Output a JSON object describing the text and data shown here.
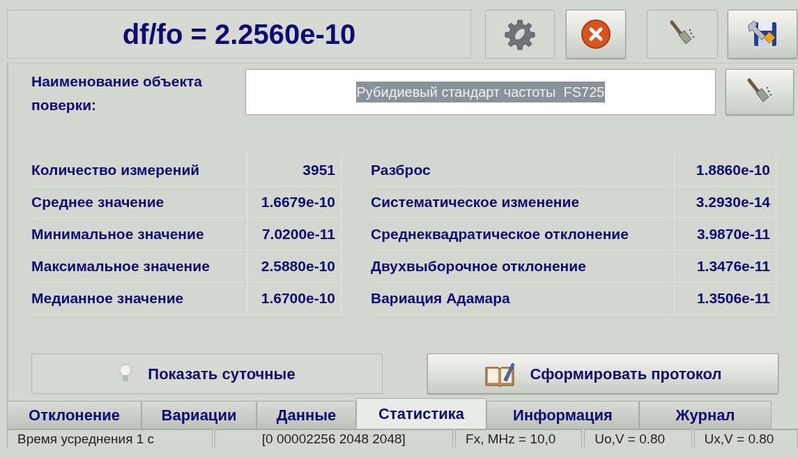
{
  "header": {
    "title": "df/fo = 2.2560e-10"
  },
  "toolbar": [
    {
      "kind": "settings",
      "raised": false
    },
    {
      "kind": "close",
      "raised": true
    },
    {
      "kind": "brush",
      "raised": false
    },
    {
      "kind": "save",
      "raised": true
    }
  ],
  "object_field": {
    "label": "Наименование объекта поверки:",
    "value": "Рубидиевый стандарт частоты  FS725",
    "highlighted": true,
    "clear_button": {
      "kind": "brush",
      "raised": true
    }
  },
  "stats_left": [
    {
      "label": "Количество измерений",
      "value": "3951"
    },
    {
      "label": "Среднее значение",
      "value": "1.6679e-10"
    },
    {
      "label": "Минимальное значение",
      "value": "7.0200e-11"
    },
    {
      "label": "Максимальное значение",
      "value": "2.5880e-10"
    },
    {
      "label": "Медианное значение",
      "value": "1.6700e-10"
    }
  ],
  "stats_right": [
    {
      "label": "Разброс",
      "value": "1.8860e-10"
    },
    {
      "label": "Систематическое изменение",
      "value": "3.2930e-14"
    },
    {
      "label": "Среднеквадратическое отклонение",
      "value": "3.9870e-11"
    },
    {
      "label": "Двухвыборочное отклонение",
      "value": "1.3476e-11"
    },
    {
      "label": "Вариация Адамара",
      "value": "1.3506e-11"
    }
  ],
  "actions": [
    {
      "label": "Показать суточные",
      "kind": "bulb",
      "raised": false
    },
    {
      "label": "Сформировать протокол",
      "kind": "book",
      "raised": true
    }
  ],
  "tabs": [
    {
      "label": "Отклонение",
      "selected": false
    },
    {
      "label": "Вариации",
      "selected": false
    },
    {
      "label": "Данные",
      "selected": false
    },
    {
      "label": "Статистика",
      "selected": true
    },
    {
      "label": "Информация",
      "selected": false
    },
    {
      "label": "Журнал",
      "selected": false
    }
  ],
  "status_bar": [
    "Время усреднения 1 с",
    "[0  00002256 2048 2048]",
    "Fx, MHz = 10,0",
    "Uo,V = 0.80",
    "Ux,V = 0.80"
  ]
}
